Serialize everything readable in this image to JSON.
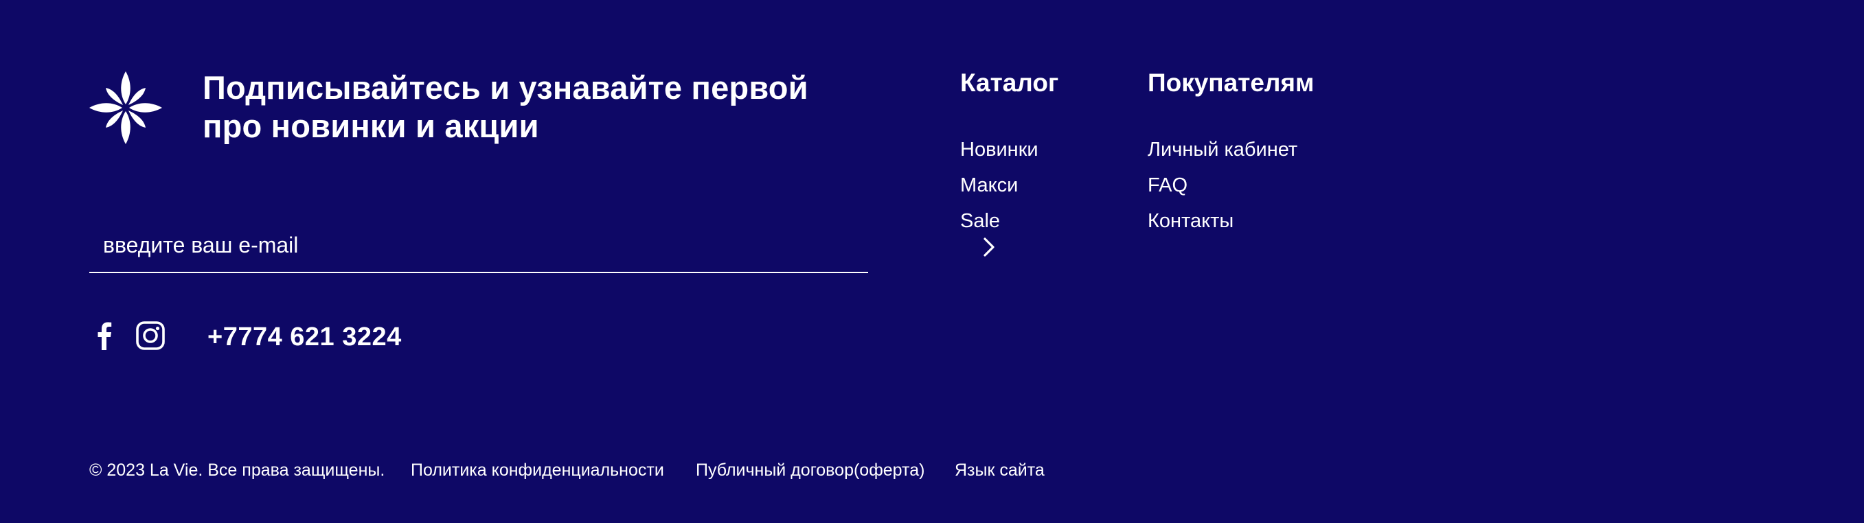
{
  "footer": {
    "background": "#0e0866",
    "text_color": "#ffffff",
    "logo_icon": "flower-icon",
    "subscribe": {
      "headline": "Подписывайтесь и узнавайте первой про новинки и акции",
      "email_placeholder": "введите ваш e-mail",
      "submit_icon": "chevron-right-icon"
    },
    "social": {
      "facebook_icon": "facebook-icon",
      "instagram_icon": "instagram-icon"
    },
    "phone": "+7774 621 3224",
    "catalog": {
      "title": "Каталог",
      "items": [
        "Новинки",
        "Макси",
        "Sale"
      ]
    },
    "buyers": {
      "title": "Покупателям",
      "items": [
        "Личный кабинет",
        "FAQ",
        "Контакты"
      ]
    },
    "bottom": {
      "copyright": "© 2023 La Vie. Все права защищены.",
      "privacy": "Политика конфиденциальности",
      "offer": "Публичный договор(оферта)",
      "language": "Язык сайта"
    }
  }
}
